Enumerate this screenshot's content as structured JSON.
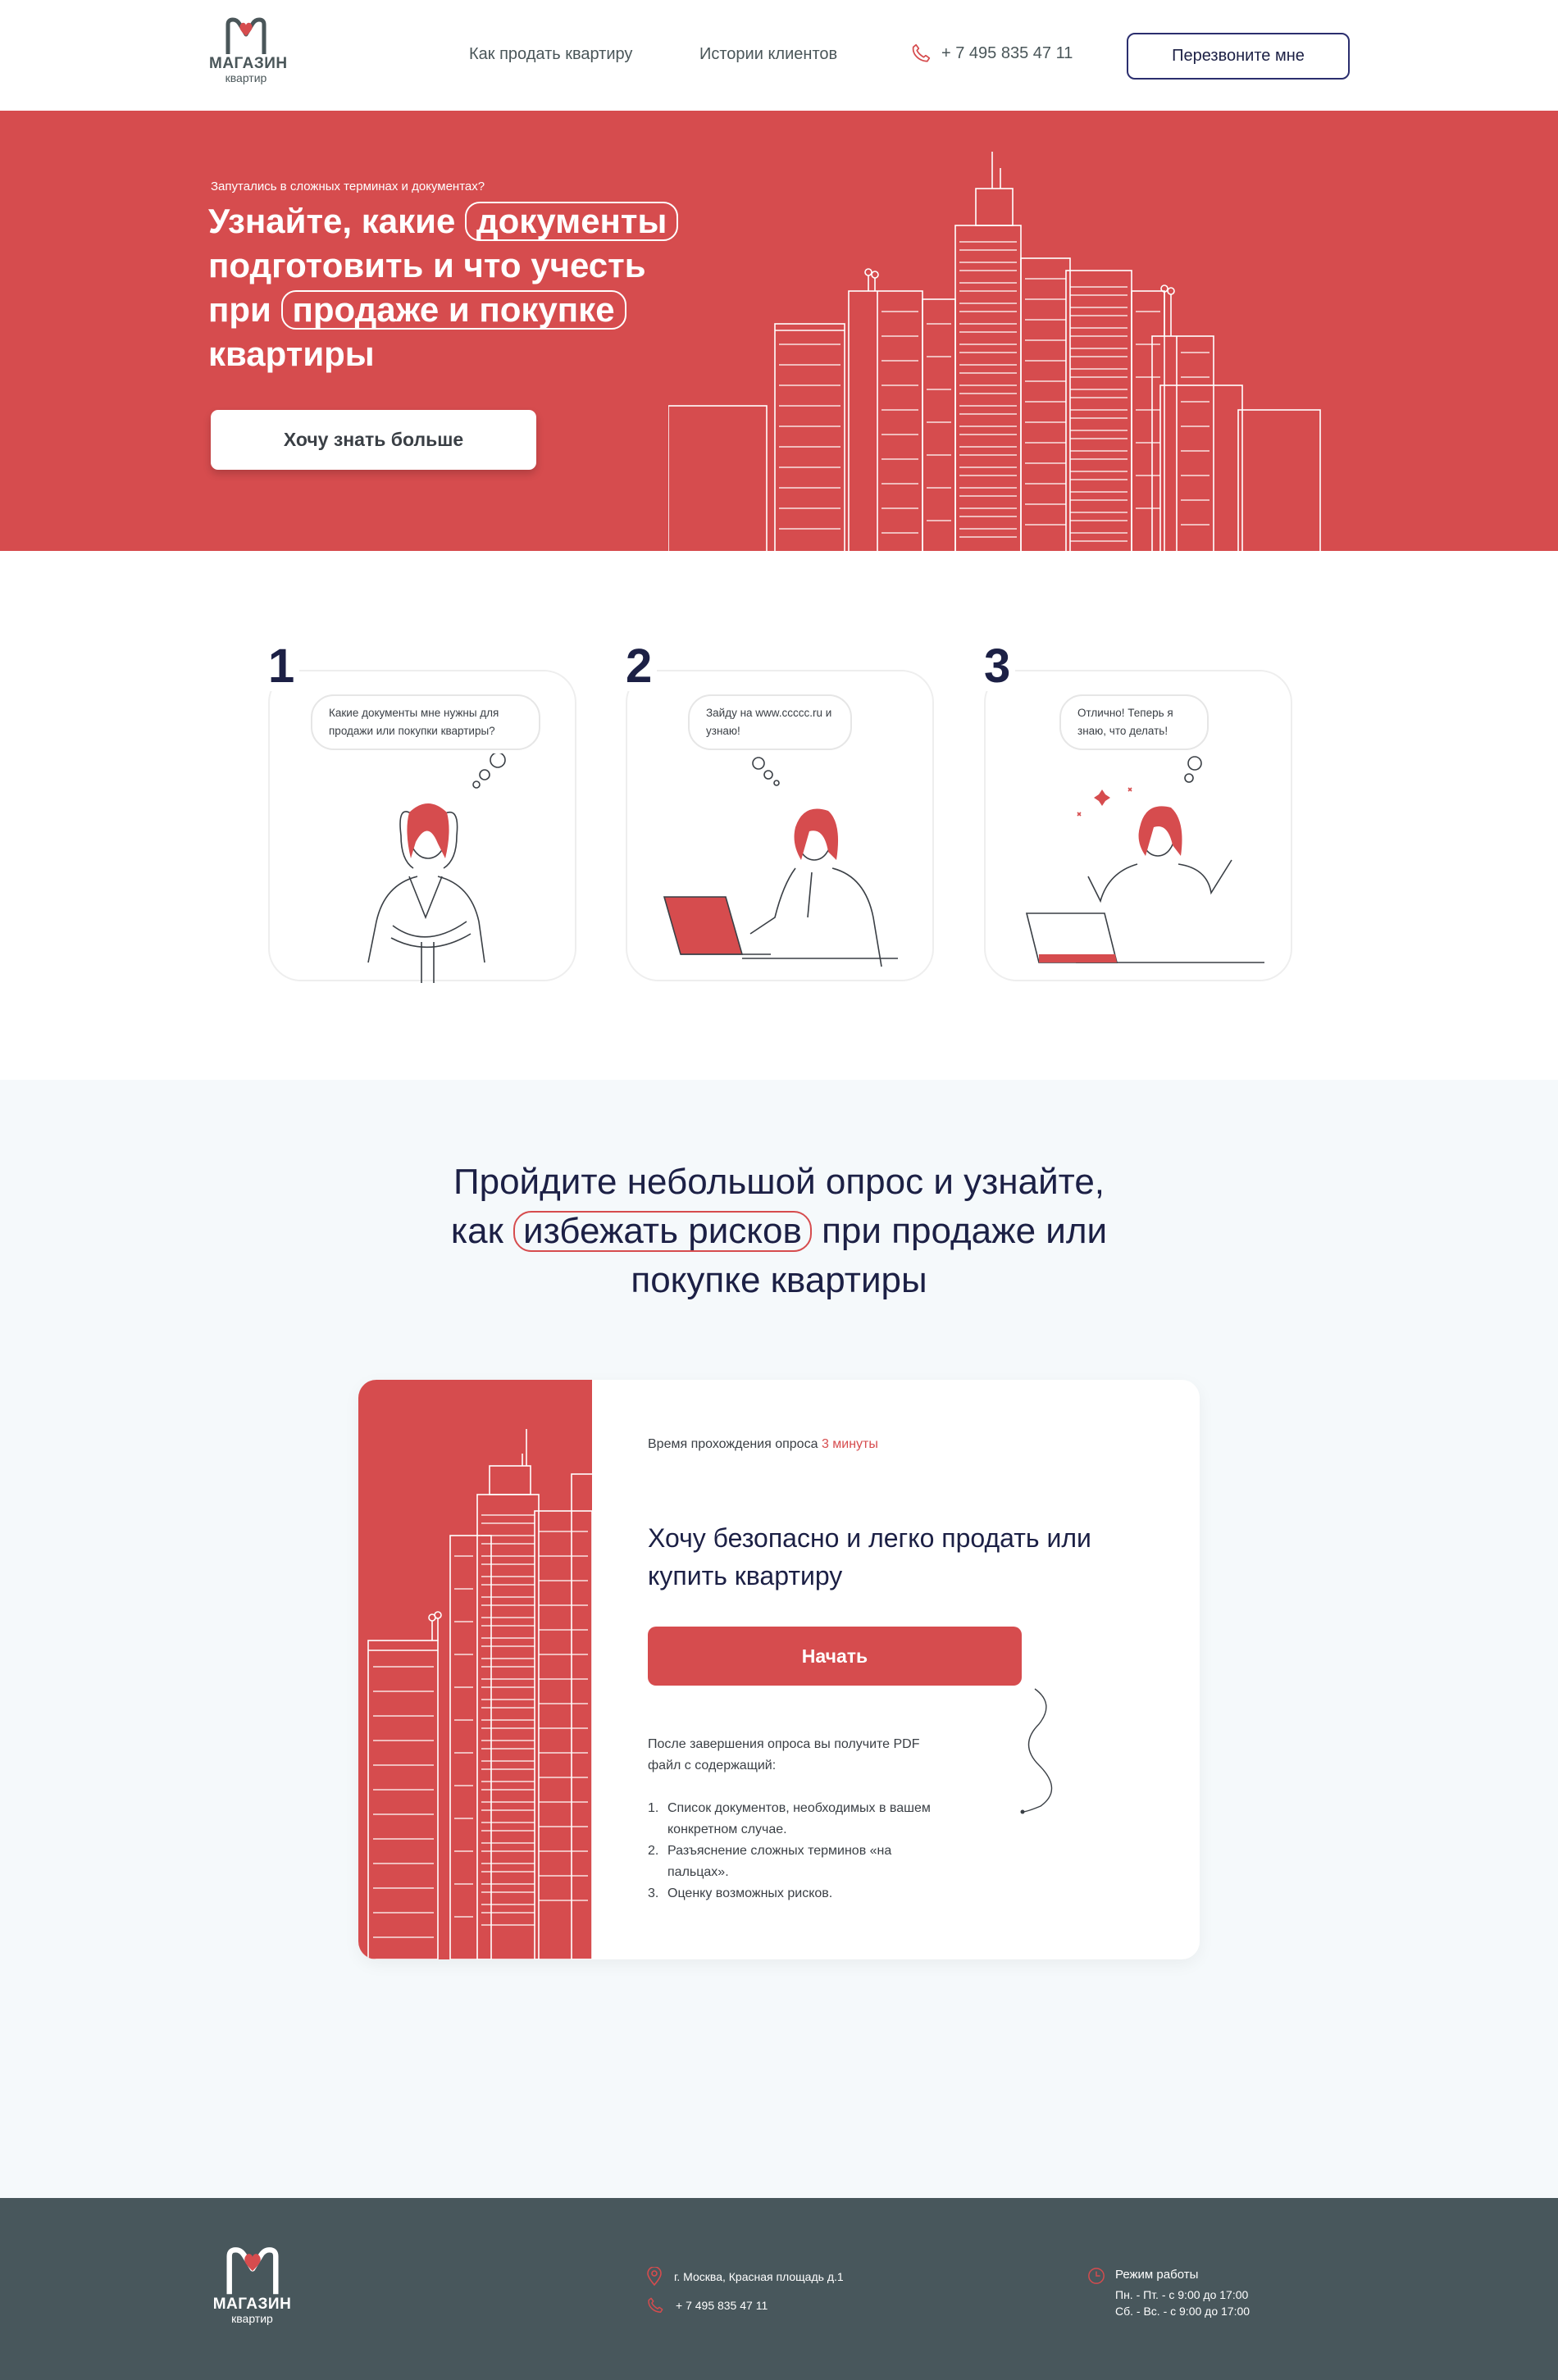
{
  "colors": {
    "brand_red": "#d64c4e",
    "navy": "#1c2045",
    "footer_bg": "#48575c",
    "section_bg": "#f5f9fb"
  },
  "header": {
    "logo": {
      "title": "МАГАЗИН",
      "subtitle": "квартир"
    },
    "nav": [
      "Как продать квартиру",
      "Истории клиентов"
    ],
    "phone": "+ 7 495 835 47 11",
    "callback_label": "Перезвоните мне"
  },
  "hero": {
    "kicker": "Запутались в сложных терминах и документах?",
    "title_part1": "Узнайте, какие",
    "title_pill1": "документы",
    "title_part2": "подготовить и что учесть",
    "title_part3": "при",
    "title_pill2": "продаже и покупке",
    "title_part4": "квартиры",
    "button_label": "Хочу знать больше"
  },
  "steps": [
    {
      "number": "1",
      "bubble": "Какие документы мне нужны для продажи или покупки квартиры?"
    },
    {
      "number": "2",
      "bubble": "Зайду на www.ccccc.ru и узнаю!"
    },
    {
      "number": "3",
      "bubble": "Отлично! Теперь я знаю, что делать!"
    }
  ],
  "quiz": {
    "heading_line1": "Пройдите небольшой опрос и узнайте,",
    "heading_pre": "как",
    "heading_pill": "избежать рисков",
    "heading_post": "при продаже или",
    "heading_line3": "покупке квартиры",
    "time_label": "Время прохождения опроса",
    "time_value": "3 минуты",
    "card_title": "Хочу безопасно и легко продать или купить квартиру",
    "start_label": "Начать",
    "note": "После завершения опроса вы получите PDF файл с содержащий:",
    "list": [
      "Список документов, необходимых в вашем конкретном случае.",
      "Разъяснение сложных терминов «на пальцах».",
      "Оценку возможных рисков."
    ]
  },
  "footer": {
    "logo": {
      "title": "МАГАЗИН",
      "subtitle": "квартир"
    },
    "address": "г. Москва, Красная площадь д.1",
    "phone": "+ 7 495 835 47 11",
    "hours_title": "Режим работы",
    "hours_weekdays": "Пн. - Пт. - с 9:00 до 17:00",
    "hours_weekend": "Сб. - Вс. - с 9:00 до 17:00"
  }
}
